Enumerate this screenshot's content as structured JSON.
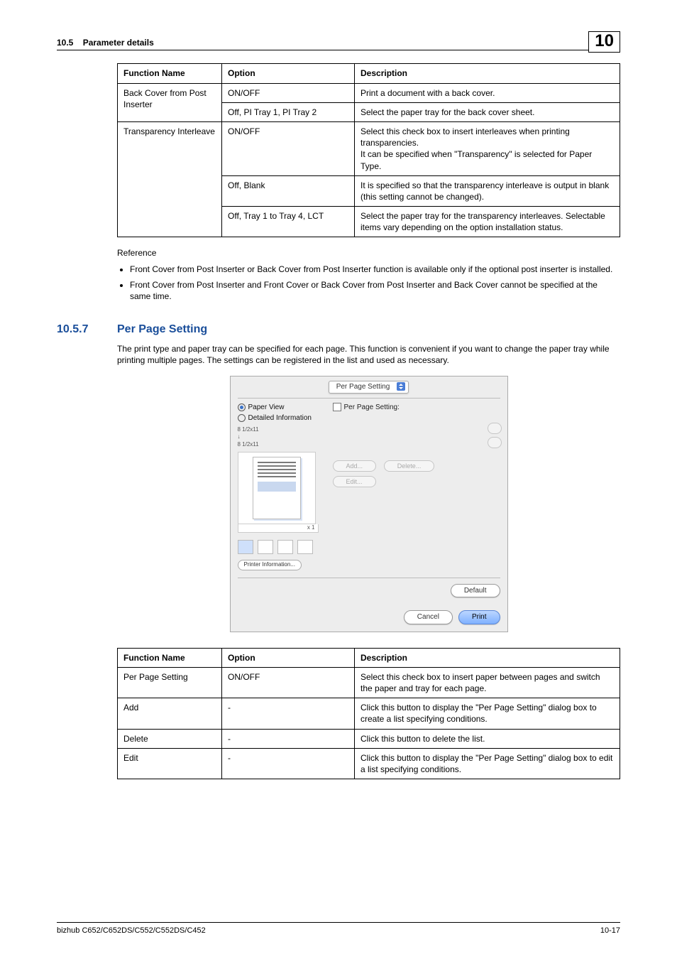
{
  "header": {
    "section_num": "10.5",
    "section_title": "Parameter details",
    "chapter": "10"
  },
  "table1": {
    "headers": {
      "fn": "Function Name",
      "opt": "Option",
      "desc": "Description"
    },
    "rows": [
      {
        "fn": "Back Cover from Post Inserter",
        "opt": "ON/OFF",
        "desc": "Print a document with a back cover."
      },
      {
        "opt": "Off, PI Tray 1, PI Tray 2",
        "desc": "Select the paper tray for the back cover sheet."
      },
      {
        "fn": "Transparency Interleave",
        "opt": "ON/OFF",
        "desc": "Select this check box to insert interleaves when printing transparencies.\nIt can be specified when \"Transparency\" is selected for Paper Type."
      },
      {
        "opt": "Off, Blank",
        "desc": "It is specified so that the transparency interleave is output in blank (this setting cannot be changed)."
      },
      {
        "opt": "Off, Tray 1 to Tray 4, LCT",
        "desc": "Select the paper tray for the transparency interleaves. Selectable items vary depending on the option installation status."
      }
    ]
  },
  "reference": {
    "label": "Reference",
    "items": [
      "Front Cover from Post Inserter or Back Cover from Post Inserter function is available only if the optional post inserter is installed.",
      "Front Cover from Post Inserter and Front Cover or Back Cover from Post Inserter and Back Cover cannot be specified at the same time."
    ]
  },
  "section": {
    "num": "10.5.7",
    "title": "Per Page Setting",
    "body": "The print type and paper tray can be specified for each page. This function is convenient if you want to change the paper tray while printing multiple pages. The settings can be registered in the list and used as necessary."
  },
  "shot": {
    "tab": "Per Page Setting",
    "radio_paper": "Paper View",
    "radio_detail": "Detailed Information",
    "size1": "8 1/2x11",
    "size2": "8 1/2x11",
    "x1": "x 1",
    "printer_info": "Printer Information...",
    "checkbox": "Per Page Setting:",
    "add": "Add...",
    "delete": "Delete...",
    "edit": "Edit...",
    "default": "Default",
    "cancel": "Cancel",
    "print": "Print"
  },
  "table2": {
    "headers": {
      "fn": "Function Name",
      "opt": "Option",
      "desc": "Description"
    },
    "rows": [
      {
        "fn": "Per Page Setting",
        "opt": "ON/OFF",
        "desc": "Select this check box to insert paper between pages and switch the paper and tray for each page."
      },
      {
        "fn": "Add",
        "opt": "-",
        "desc": "Click this button to display the \"Per Page Setting\" dialog box to create a list specifying conditions."
      },
      {
        "fn": "Delete",
        "opt": "-",
        "desc": "Click this button to delete the list."
      },
      {
        "fn": "Edit",
        "opt": "-",
        "desc": "Click this button to display the \"Per Page Setting\" dialog box to edit a list specifying conditions."
      }
    ]
  },
  "footer": {
    "left": "bizhub C652/C652DS/C552/C552DS/C452",
    "right": "10-17"
  }
}
